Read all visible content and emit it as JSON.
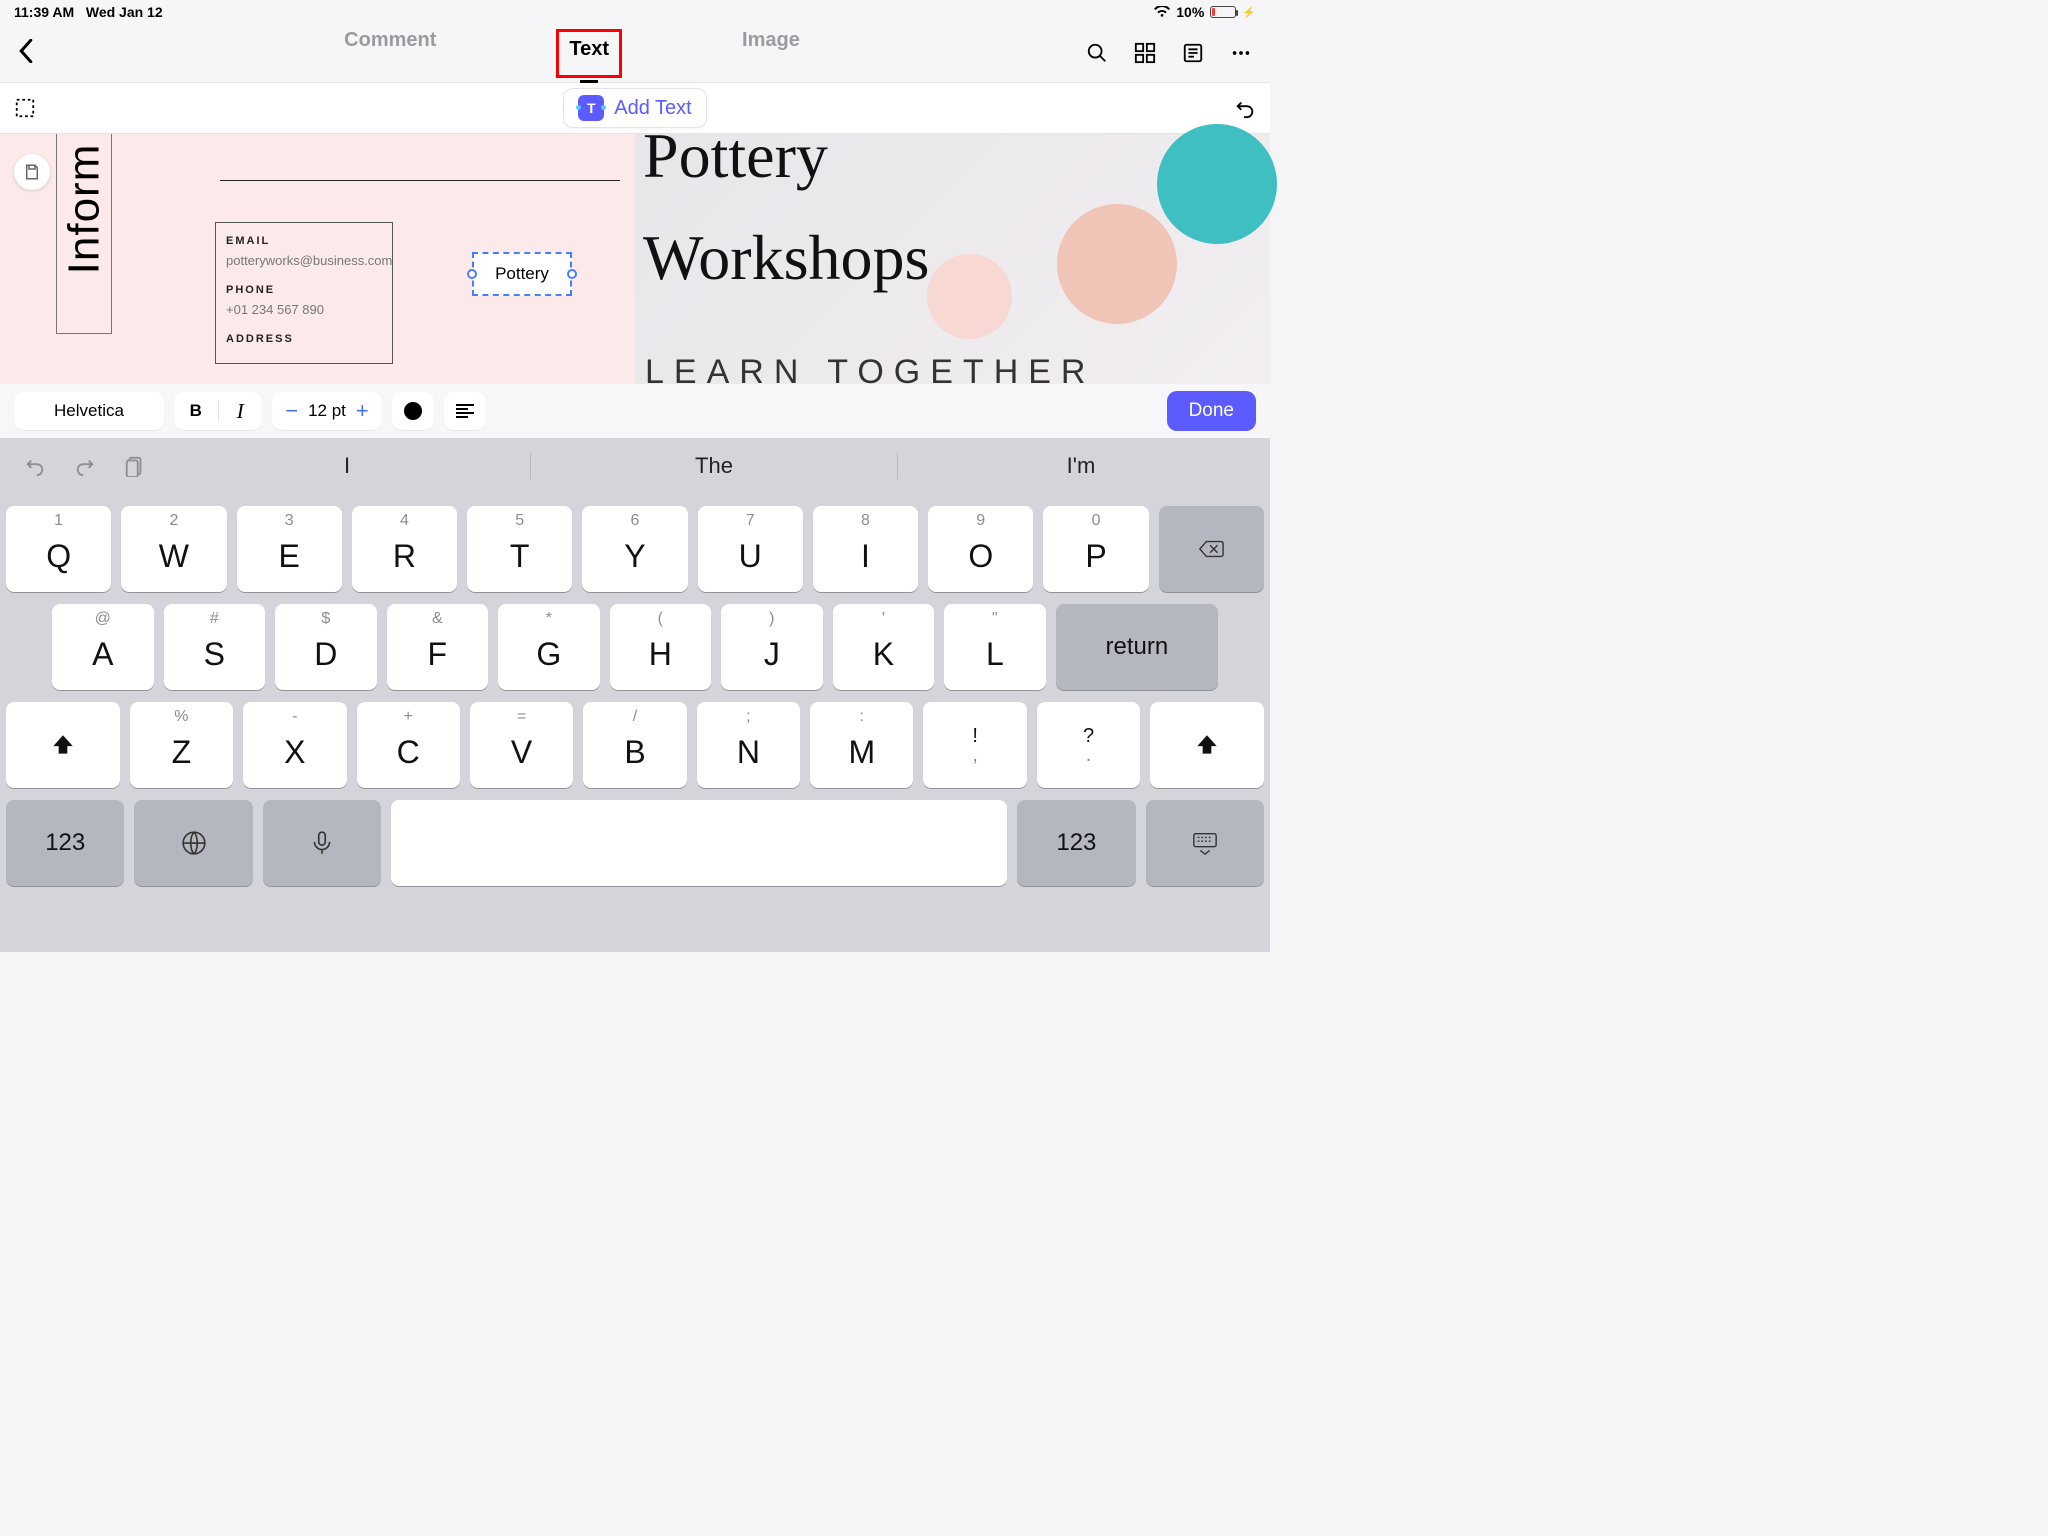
{
  "statusbar": {
    "time": "11:39 AM",
    "date": "Wed Jan 12",
    "battery_pct": "10%"
  },
  "topnav": {
    "tabs": {
      "comment": "Comment",
      "text": "Text",
      "image": "Image"
    }
  },
  "secondbar": {
    "add_text": "Add Text"
  },
  "canvas": {
    "side_label": "Inform",
    "card": {
      "email_h": "EMAIL",
      "email_v": "potteryworks@business.com",
      "phone_h": "PHONE",
      "phone_v": "+01 234 567 890",
      "addr_h": "ADDRESS"
    },
    "selection_text": "Pottery",
    "right": {
      "line1": "Pottery",
      "line2": "Workshops",
      "sub": "LEARN TOGETHER"
    }
  },
  "format": {
    "font": "Helvetica",
    "size": "12 pt",
    "done": "Done"
  },
  "keyboard": {
    "predict": [
      "I",
      "The",
      "I'm"
    ],
    "row1": [
      {
        "alt": "1",
        "main": "Q"
      },
      {
        "alt": "2",
        "main": "W"
      },
      {
        "alt": "3",
        "main": "E"
      },
      {
        "alt": "4",
        "main": "R"
      },
      {
        "alt": "5",
        "main": "T"
      },
      {
        "alt": "6",
        "main": "Y"
      },
      {
        "alt": "7",
        "main": "U"
      },
      {
        "alt": "8",
        "main": "I"
      },
      {
        "alt": "9",
        "main": "O"
      },
      {
        "alt": "0",
        "main": "P"
      }
    ],
    "row2": [
      {
        "alt": "@",
        "main": "A"
      },
      {
        "alt": "#",
        "main": "S"
      },
      {
        "alt": "$",
        "main": "D"
      },
      {
        "alt": "&",
        "main": "F"
      },
      {
        "alt": "*",
        "main": "G"
      },
      {
        "alt": "(",
        "main": "H"
      },
      {
        "alt": ")",
        "main": "J"
      },
      {
        "alt": "'",
        "main": "K"
      },
      {
        "alt": "\"",
        "main": "L"
      }
    ],
    "return": "return",
    "row3": [
      {
        "alt": "%",
        "main": "Z"
      },
      {
        "alt": "-",
        "main": "X"
      },
      {
        "alt": "+",
        "main": "C"
      },
      {
        "alt": "=",
        "main": "V"
      },
      {
        "alt": "/",
        "main": "B"
      },
      {
        "alt": ";",
        "main": "N"
      },
      {
        "alt": ":",
        "main": "M"
      }
    ],
    "punct": [
      {
        "up": "!",
        "dn": ","
      },
      {
        "up": "?",
        "dn": "."
      }
    ],
    "numkey": "123"
  }
}
